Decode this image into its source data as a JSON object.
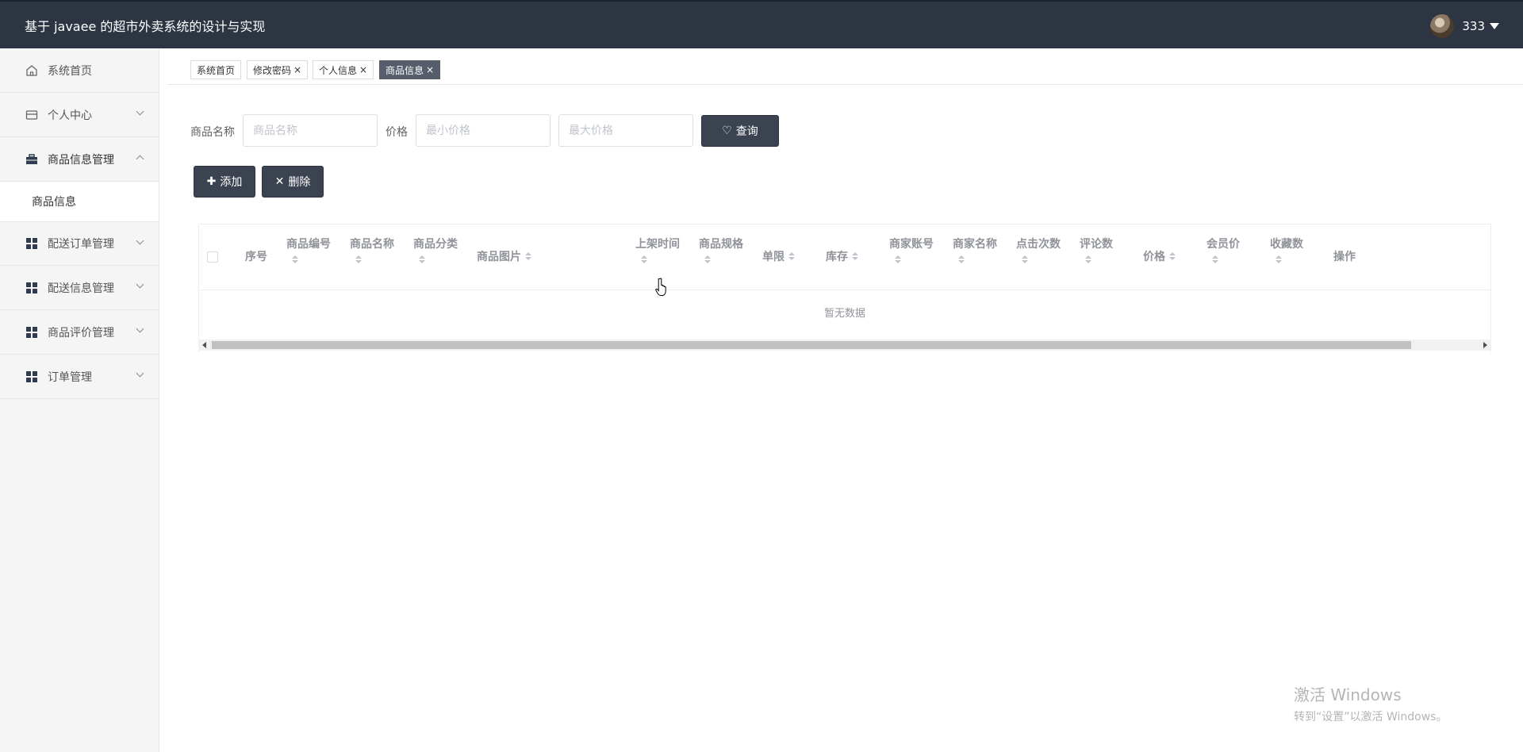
{
  "header": {
    "title": "基于 javaee 的超市外卖系统的设计与实现",
    "username": "333"
  },
  "sidebar": {
    "items": [
      {
        "label": "系统首页"
      },
      {
        "label": "个人中心"
      },
      {
        "label": "商品信息管理"
      },
      {
        "label": "配送订单管理"
      },
      {
        "label": "配送信息管理"
      },
      {
        "label": "商品评价管理"
      },
      {
        "label": "订单管理"
      }
    ],
    "submenu": {
      "label": "商品信息"
    }
  },
  "tabs": [
    {
      "label": "系统首页",
      "close": ""
    },
    {
      "label": "修改密码",
      "close": "×"
    },
    {
      "label": "个人信息",
      "close": "×"
    },
    {
      "label": "商品信息",
      "close": "×"
    }
  ],
  "search": {
    "name_label": "商品名称",
    "name_placeholder": "商品名称",
    "price_label": "价格",
    "min_placeholder": "最小价格",
    "max_placeholder": "最大价格",
    "query_label": "查询"
  },
  "actions": {
    "add_label": "添加",
    "delete_label": "删除"
  },
  "table": {
    "columns": [
      "序号",
      "商品编号",
      "商品名称",
      "商品分类",
      "商品图片",
      "上架时间",
      "商品规格",
      "单限",
      "库存",
      "商家账号",
      "商家名称",
      "点击次数",
      "评论数",
      "价格",
      "会员价",
      "收藏数",
      "操作"
    ],
    "empty_text": "暂无数据"
  },
  "watermark": {
    "line1": "激活 Windows",
    "line2": "转到“设置”以激活 Windows。"
  }
}
